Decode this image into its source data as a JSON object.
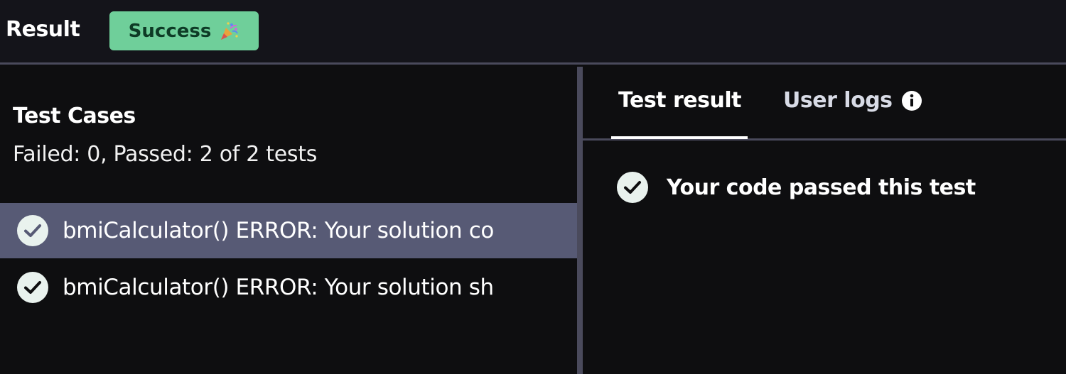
{
  "header": {
    "title": "Result",
    "status_badge": "Success",
    "status_icon": "party-popper-icon",
    "badge_color": "#6fcf9a"
  },
  "test_cases": {
    "title": "Test Cases",
    "summary": "Failed: 0, Passed: 2 of 2 tests",
    "items": [
      {
        "label": "bmiCalculator() ERROR: Your solution co",
        "status": "passed",
        "selected": true
      },
      {
        "label": "bmiCalculator() ERROR: Your solution sh",
        "status": "passed",
        "selected": false
      }
    ]
  },
  "details": {
    "tabs": [
      {
        "label": "Test result",
        "active": true
      },
      {
        "label": "User logs",
        "icon": "info-icon",
        "active": false
      }
    ],
    "result_message": "Your code passed this test"
  }
}
